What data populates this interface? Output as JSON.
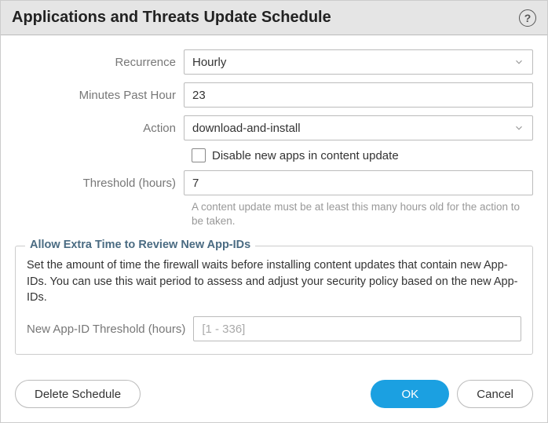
{
  "header": {
    "title": "Applications and Threats Update Schedule"
  },
  "form": {
    "recurrence": {
      "label": "Recurrence",
      "value": "Hourly"
    },
    "minutesPastHour": {
      "label": "Minutes Past Hour",
      "value": "23"
    },
    "action": {
      "label": "Action",
      "value": "download-and-install"
    },
    "disableNewApps": {
      "label": "Disable new apps in content update"
    },
    "threshold": {
      "label": "Threshold (hours)",
      "value": "7",
      "help": "A content update must be at least this many hours old for the action to be taken."
    }
  },
  "fieldset": {
    "legend": "Allow Extra Time to Review New App-IDs",
    "desc": "Set the amount of time the firewall waits before installing content updates that contain new App-IDs. You can use this wait period to assess and adjust your security policy based on the new App-IDs.",
    "newAppIdThreshold": {
      "label": "New App-ID Threshold (hours)",
      "placeholder": "[1 - 336]"
    }
  },
  "footer": {
    "delete": "Delete Schedule",
    "ok": "OK",
    "cancel": "Cancel"
  }
}
